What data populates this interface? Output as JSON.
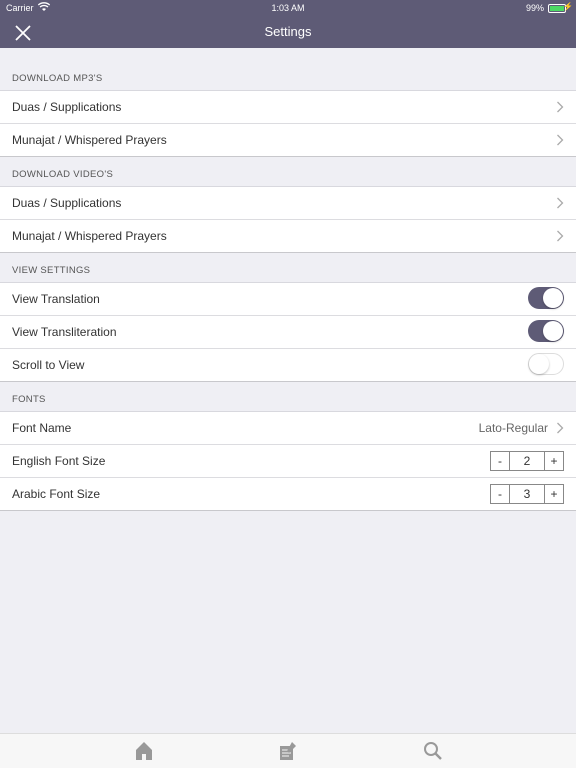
{
  "status_bar": {
    "carrier": "Carrier",
    "time": "1:03 AM",
    "battery": "99%"
  },
  "header": {
    "title": "Settings",
    "close_icon": "close-icon"
  },
  "sections": {
    "mp3": {
      "title": "DOWNLOAD MP3'S",
      "items": [
        "Duas / Supplications",
        "Munajat / Whispered Prayers"
      ]
    },
    "video": {
      "title": "DOWNLOAD VIDEO'S",
      "items": [
        "Duas / Supplications",
        "Munajat / Whispered Prayers"
      ]
    },
    "view": {
      "title": "VIEW SETTINGS",
      "view_translation": {
        "label": "View Translation",
        "on": true
      },
      "view_transliteration": {
        "label": "View Transliteration",
        "on": true
      },
      "scroll_to_view": {
        "label": "Scroll to View",
        "on": false
      }
    },
    "fonts": {
      "title": "FONTS",
      "font_name": {
        "label": "Font Name",
        "value": "Lato-Regular"
      },
      "english_size": {
        "label": "English Font Size",
        "value": "2",
        "minus": "-",
        "plus": "+"
      },
      "arabic_size": {
        "label": "Arabic Font Size",
        "value": "3",
        "minus": "-",
        "plus": "+"
      }
    }
  },
  "tabbar": {
    "items": [
      "home-icon",
      "notes-icon",
      "search-icon"
    ]
  },
  "colors": {
    "header": "#5e5b76",
    "background": "#efeff4",
    "toggle_on": "#5e5b76"
  }
}
